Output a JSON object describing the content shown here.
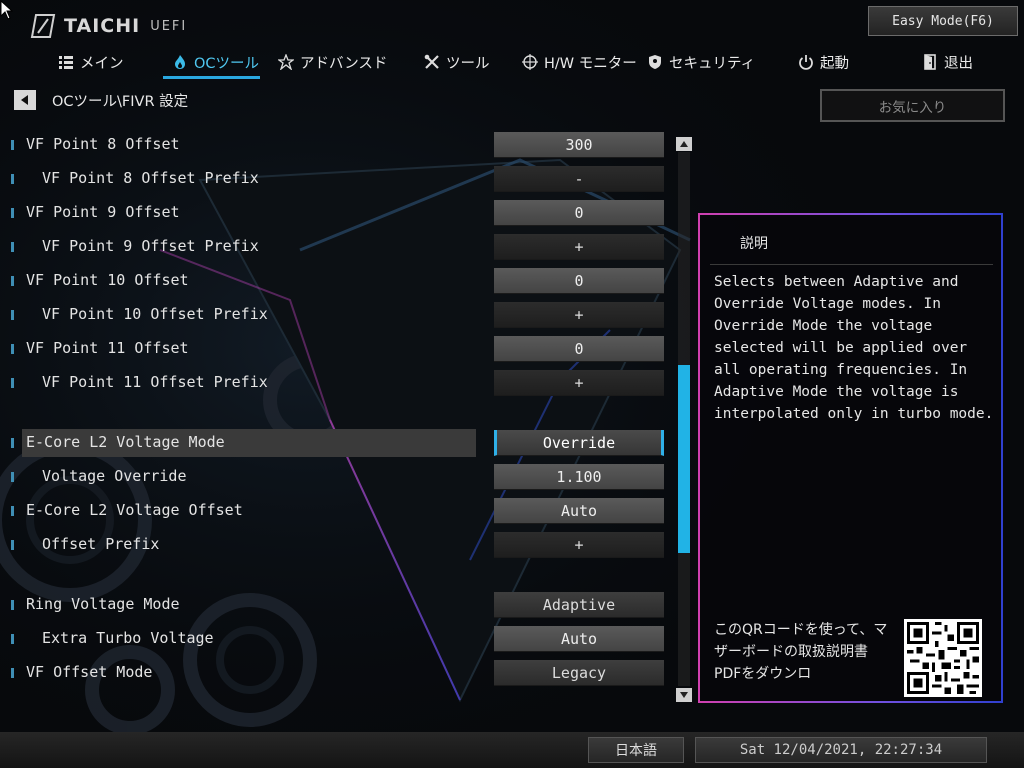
{
  "header": {
    "logo_text": "TAICHI",
    "logo_sub": "UEFI",
    "easy_mode_label": "Easy Mode(F6)"
  },
  "nav": {
    "items": [
      {
        "label": "メイン",
        "icon": "list-icon"
      },
      {
        "label": "OCツール",
        "icon": "flame-icon",
        "active": true
      },
      {
        "label": "アドバンスド",
        "icon": "star-icon"
      },
      {
        "label": "ツール",
        "icon": "tools-icon"
      },
      {
        "label": "H/W モニター",
        "icon": "crosshair-icon"
      },
      {
        "label": "セキュリティ",
        "icon": "shield-icon"
      },
      {
        "label": "起動",
        "icon": "power-icon"
      },
      {
        "label": "退出",
        "icon": "exit-door-icon"
      }
    ]
  },
  "breadcrumb": "OCツール\\FIVR 設定",
  "favorites_label": "お気に入り",
  "settings": [
    {
      "label": "VF Point 8 Offset",
      "value": "300",
      "indent": false,
      "style": "light"
    },
    {
      "label": "VF Point 8 Offset Prefix",
      "value": "-",
      "indent": true,
      "style": "dark"
    },
    {
      "label": "VF Point 9 Offset",
      "value": "0",
      "indent": false,
      "style": "light"
    },
    {
      "label": "VF Point 9 Offset Prefix",
      "value": "+",
      "indent": true,
      "style": "dark"
    },
    {
      "label": "VF Point 10 Offset",
      "value": "0",
      "indent": false,
      "style": "light"
    },
    {
      "label": "VF Point 10 Offset Prefix",
      "value": "+",
      "indent": true,
      "style": "dark"
    },
    {
      "label": "VF Point 11 Offset",
      "value": "0",
      "indent": false,
      "style": "light"
    },
    {
      "label": "VF Point 11 Offset Prefix",
      "value": "+",
      "indent": true,
      "style": "dark"
    },
    {
      "label": "E-Core L2 Voltage Mode",
      "value": "Override",
      "indent": false,
      "selected": true
    },
    {
      "label": "Voltage Override",
      "value": "1.100",
      "indent": true,
      "style": "light"
    },
    {
      "label": "E-Core L2 Voltage Offset",
      "value": "Auto",
      "indent": false,
      "style": "light"
    },
    {
      "label": "Offset Prefix",
      "value": "+",
      "indent": true,
      "style": "dark"
    },
    {
      "label": "Ring Voltage Mode",
      "value": "Adaptive",
      "indent": false,
      "style": "normal"
    },
    {
      "label": "Extra Turbo Voltage",
      "value": "Auto",
      "indent": true,
      "style": "light"
    },
    {
      "label": "VF Offset Mode",
      "value": "Legacy",
      "indent": false,
      "style": "normal"
    }
  ],
  "description": {
    "title": "説明",
    "text": "Selects between Adaptive and Override Voltage modes. In Override Mode the voltage selected will be applied over all operating frequencies. In Adaptive Mode the voltage is interpolated only in turbo mode.",
    "qr_text": "このQRコードを使って、マザーボードの取扱説明書PDFをダウンロ"
  },
  "footer": {
    "language": "日本語",
    "datetime": "Sat 12/04/2021, 22:27:34"
  }
}
